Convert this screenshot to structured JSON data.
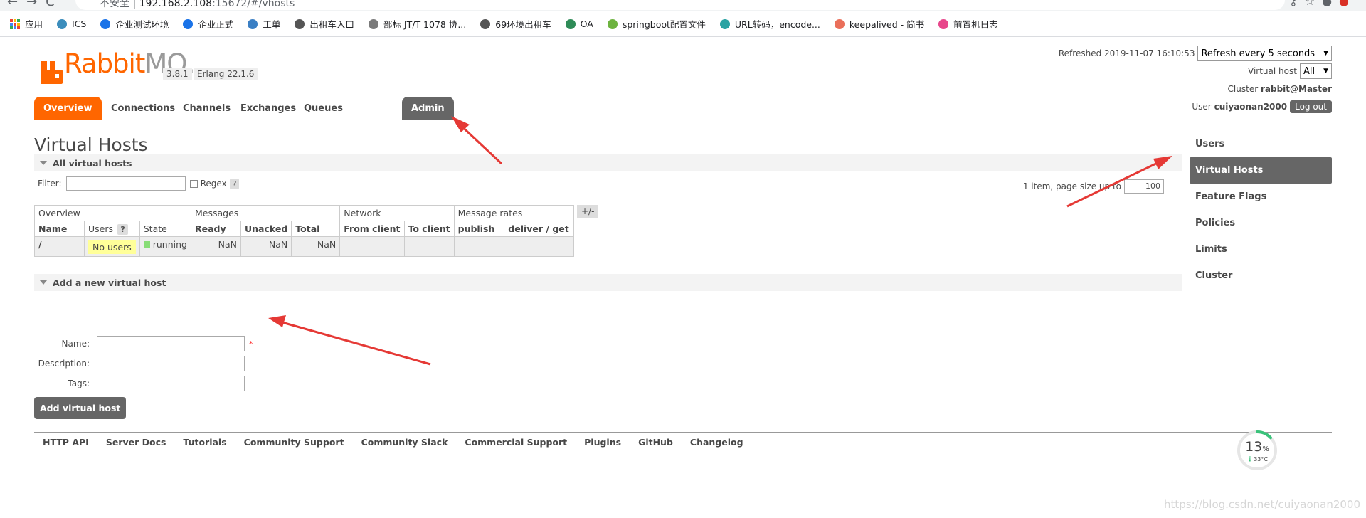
{
  "browser": {
    "url_prefix": "不安全 |",
    "url_host": "192.168.2.108",
    "url_rest": ":15672/#/vhosts",
    "bookmarks": [
      {
        "label": "应用",
        "icon": "apps-grid-icon"
      },
      {
        "label": "ICS",
        "icon": "globe-icon",
        "color": "#3c8dbc"
      },
      {
        "label": "企业测试环境",
        "icon": "ie-icon",
        "color": "#1a73e8"
      },
      {
        "label": "企业正式",
        "icon": "ie-icon",
        "color": "#1a73e8"
      },
      {
        "label": "工单",
        "icon": "ticket-icon",
        "color": "#3a7fc4"
      },
      {
        "label": "出租车入口",
        "icon": "globe-icon",
        "color": "#555555"
      },
      {
        "label": "部标 JT/T 1078 协...",
        "icon": "doc-icon",
        "color": "#7a7a7a"
      },
      {
        "label": "69环境出租车",
        "icon": "globe-icon",
        "color": "#555555"
      },
      {
        "label": "OA",
        "icon": "gear-icon",
        "color": "#2e8b57"
      },
      {
        "label": "springboot配置文件",
        "icon": "spring-icon",
        "color": "#6db33f"
      },
      {
        "label": "URL转码，encode...",
        "icon": "gear-icon",
        "color": "#2ba3a3"
      },
      {
        "label": "keepalived - 简书",
        "icon": "jianshu-icon",
        "color": "#ea6f5a"
      },
      {
        "label": "前置机日志",
        "icon": "kibana-icon",
        "color": "#e8478b"
      }
    ]
  },
  "header": {
    "brand_rabbit": "Rabbit",
    "brand_mq": "MQ",
    "brand_tm": "TM",
    "version": "3.8.1",
    "erlang": "Erlang 22.1.6",
    "refreshed_label": "Refreshed 2019-11-07 16:10:53",
    "refresh_select": "Refresh every 5 seconds",
    "vhost_label": "Virtual host",
    "vhost_select": "All",
    "cluster_label": "Cluster",
    "cluster_name": "rabbit@Master",
    "user_label": "User",
    "user_name": "cuiyaonan2000",
    "logout": "Log out"
  },
  "tabs": [
    "Overview",
    "Connections",
    "Channels",
    "Exchanges",
    "Queues",
    "Admin"
  ],
  "page_title": "Virtual Hosts",
  "all_vhosts": {
    "header": "All virtual hosts",
    "filter_label": "Filter:",
    "filter_value": "",
    "regex_label": "Regex",
    "help": "?",
    "paging_text": "1 item, page size up to",
    "page_size": "100",
    "plus_minus": "+/-"
  },
  "table": {
    "groups": [
      "Overview",
      "Messages",
      "Network",
      "Message rates"
    ],
    "columns": [
      "Name",
      "Users",
      "State",
      "Ready",
      "Unacked",
      "Total",
      "From client",
      "To client",
      "publish",
      "deliver / get"
    ],
    "rows": [
      {
        "name": "/",
        "users": "No users",
        "state": "running",
        "ready": "NaN",
        "unacked": "NaN",
        "total": "NaN",
        "from_client": "",
        "to_client": "",
        "publish": "",
        "deliver_get": ""
      }
    ]
  },
  "add_vhost": {
    "header": "Add a new virtual host",
    "name_label": "Name:",
    "description_label": "Description:",
    "tags_label": "Tags:",
    "required_mark": "*",
    "button": "Add virtual host"
  },
  "footer": [
    "HTTP API",
    "Server Docs",
    "Tutorials",
    "Community Support",
    "Community Slack",
    "Commercial Support",
    "Plugins",
    "GitHub",
    "Changelog"
  ],
  "sidebar": [
    "Users",
    "Virtual Hosts",
    "Feature Flags",
    "Policies",
    "Limits",
    "Cluster"
  ],
  "sidebar_active": "Virtual Hosts",
  "widget": {
    "percent": "13",
    "percent_unit": "%",
    "temp": "33°C",
    "progress": 0.13
  },
  "watermark": "https://blog.csdn.net/cuiyaonan2000",
  "colors": {
    "brand": "#ff6600",
    "active_tab": "#ff6600",
    "admin_tab": "#666666",
    "annotation": "#e53935",
    "running": "#88dd77",
    "no_users": "#ffff99"
  }
}
